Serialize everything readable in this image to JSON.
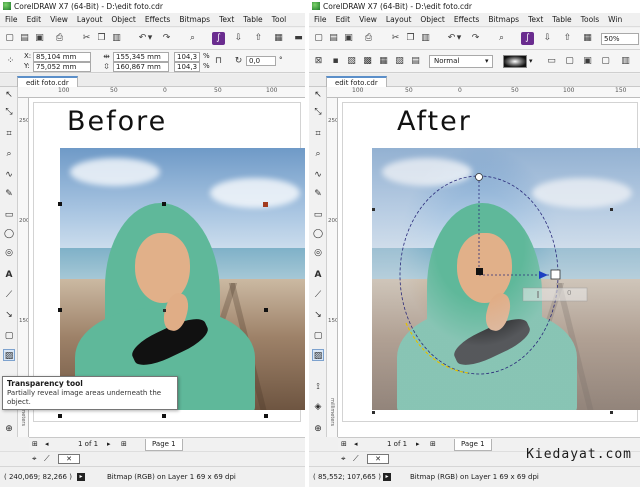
{
  "left": {
    "title": "CorelDRAW X7 (64-Bit) - D:\\edit foto.cdr",
    "menu": [
      "File",
      "Edit",
      "View",
      "Layout",
      "Object",
      "Effects",
      "Bitmaps",
      "Text",
      "Table",
      "Tool"
    ],
    "prop": {
      "x": "85,104 mm",
      "y": "75,052 mm",
      "w": "155,345 mm",
      "h": "160,867 mm",
      "sx": "104,3",
      "sy": "104,3",
      "pct1": "%",
      "pct2": "%",
      "angle": "0,0",
      "deg": "°"
    },
    "doc_tab": "edit foto.cdr",
    "ruler_h": [
      "100",
      "50",
      "0",
      "50",
      "100"
    ],
    "ruler_v": [
      "250",
      "200",
      "150"
    ],
    "ruler_unit": "millimeters",
    "heading": "Before",
    "page_nav": "1 of 1",
    "page_tab": "Page 1",
    "tooltip": {
      "title": "Transparency tool",
      "desc": "Partially reveal image areas underneath the object."
    },
    "status_coords": "( 240,069; 82,266 )",
    "status_info": "Bitmap  (RGB) on Layer 1 69 x 69 dpi"
  },
  "right": {
    "title": "CorelDRAW X7 (64-Bit) - D:\\edit foto.cdr",
    "menu": [
      "File",
      "Edit",
      "View",
      "Layout",
      "Object",
      "Effects",
      "Bitmaps",
      "Text",
      "Table",
      "Tools",
      "Win"
    ],
    "zoom": "50%",
    "merge_mode": "Normal",
    "doc_tab": "edit foto.cdr",
    "ruler_h": [
      "100",
      "50",
      "0",
      "50",
      "100",
      "150"
    ],
    "ruler_v": [
      "250",
      "200",
      "150"
    ],
    "ruler_unit": "millimeters",
    "heading": "After",
    "slider_value": "0",
    "page_nav": "1 of 1",
    "page_tab": "Page 1",
    "status_coords": "( 85,552; 107,665 )",
    "status_info": "Bitmap  (RGB) on Layer 1 69 x 69 dpi"
  },
  "watermark": "Kiedayat.com",
  "icons": [
    "app-logo-icon",
    "new-icon",
    "open-icon",
    "save-icon",
    "cut-icon",
    "copy-icon",
    "paste-icon",
    "undo-icon",
    "redo-icon",
    "search-icon",
    "import-icon",
    "export-icon",
    "publish-icon",
    "corel-connect-icon",
    "pick-tool-icon",
    "shape-tool-icon",
    "crop-tool-icon",
    "zoom-tool-icon",
    "freehand-tool-icon",
    "artistic-media-icon",
    "rectangle-tool-icon",
    "ellipse-tool-icon",
    "polygon-tool-icon",
    "text-tool-icon",
    "parallel-dimension-icon",
    "connector-tool-icon",
    "drop-shadow-icon",
    "transparency-tool-icon",
    "eyedropper-icon",
    "interactive-fill-icon",
    "smart-fill-icon",
    "add-page-icon"
  ]
}
